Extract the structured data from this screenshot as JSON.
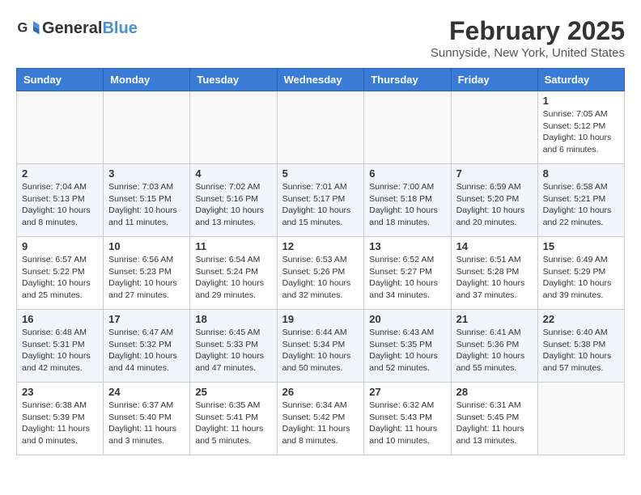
{
  "header": {
    "logo_text_general": "General",
    "logo_text_blue": "Blue",
    "title": "February 2025",
    "subtitle": "Sunnyside, New York, United States"
  },
  "weekdays": [
    "Sunday",
    "Monday",
    "Tuesday",
    "Wednesday",
    "Thursday",
    "Friday",
    "Saturday"
  ],
  "weeks": [
    [
      {
        "day": "",
        "info": ""
      },
      {
        "day": "",
        "info": ""
      },
      {
        "day": "",
        "info": ""
      },
      {
        "day": "",
        "info": ""
      },
      {
        "day": "",
        "info": ""
      },
      {
        "day": "",
        "info": ""
      },
      {
        "day": "1",
        "info": "Sunrise: 7:05 AM\nSunset: 5:12 PM\nDaylight: 10 hours\nand 6 minutes."
      }
    ],
    [
      {
        "day": "2",
        "info": "Sunrise: 7:04 AM\nSunset: 5:13 PM\nDaylight: 10 hours\nand 8 minutes."
      },
      {
        "day": "3",
        "info": "Sunrise: 7:03 AM\nSunset: 5:15 PM\nDaylight: 10 hours\nand 11 minutes."
      },
      {
        "day": "4",
        "info": "Sunrise: 7:02 AM\nSunset: 5:16 PM\nDaylight: 10 hours\nand 13 minutes."
      },
      {
        "day": "5",
        "info": "Sunrise: 7:01 AM\nSunset: 5:17 PM\nDaylight: 10 hours\nand 15 minutes."
      },
      {
        "day": "6",
        "info": "Sunrise: 7:00 AM\nSunset: 5:18 PM\nDaylight: 10 hours\nand 18 minutes."
      },
      {
        "day": "7",
        "info": "Sunrise: 6:59 AM\nSunset: 5:20 PM\nDaylight: 10 hours\nand 20 minutes."
      },
      {
        "day": "8",
        "info": "Sunrise: 6:58 AM\nSunset: 5:21 PM\nDaylight: 10 hours\nand 22 minutes."
      }
    ],
    [
      {
        "day": "9",
        "info": "Sunrise: 6:57 AM\nSunset: 5:22 PM\nDaylight: 10 hours\nand 25 minutes."
      },
      {
        "day": "10",
        "info": "Sunrise: 6:56 AM\nSunset: 5:23 PM\nDaylight: 10 hours\nand 27 minutes."
      },
      {
        "day": "11",
        "info": "Sunrise: 6:54 AM\nSunset: 5:24 PM\nDaylight: 10 hours\nand 29 minutes."
      },
      {
        "day": "12",
        "info": "Sunrise: 6:53 AM\nSunset: 5:26 PM\nDaylight: 10 hours\nand 32 minutes."
      },
      {
        "day": "13",
        "info": "Sunrise: 6:52 AM\nSunset: 5:27 PM\nDaylight: 10 hours\nand 34 minutes."
      },
      {
        "day": "14",
        "info": "Sunrise: 6:51 AM\nSunset: 5:28 PM\nDaylight: 10 hours\nand 37 minutes."
      },
      {
        "day": "15",
        "info": "Sunrise: 6:49 AM\nSunset: 5:29 PM\nDaylight: 10 hours\nand 39 minutes."
      }
    ],
    [
      {
        "day": "16",
        "info": "Sunrise: 6:48 AM\nSunset: 5:31 PM\nDaylight: 10 hours\nand 42 minutes."
      },
      {
        "day": "17",
        "info": "Sunrise: 6:47 AM\nSunset: 5:32 PM\nDaylight: 10 hours\nand 44 minutes."
      },
      {
        "day": "18",
        "info": "Sunrise: 6:45 AM\nSunset: 5:33 PM\nDaylight: 10 hours\nand 47 minutes."
      },
      {
        "day": "19",
        "info": "Sunrise: 6:44 AM\nSunset: 5:34 PM\nDaylight: 10 hours\nand 50 minutes."
      },
      {
        "day": "20",
        "info": "Sunrise: 6:43 AM\nSunset: 5:35 PM\nDaylight: 10 hours\nand 52 minutes."
      },
      {
        "day": "21",
        "info": "Sunrise: 6:41 AM\nSunset: 5:36 PM\nDaylight: 10 hours\nand 55 minutes."
      },
      {
        "day": "22",
        "info": "Sunrise: 6:40 AM\nSunset: 5:38 PM\nDaylight: 10 hours\nand 57 minutes."
      }
    ],
    [
      {
        "day": "23",
        "info": "Sunrise: 6:38 AM\nSunset: 5:39 PM\nDaylight: 11 hours\nand 0 minutes."
      },
      {
        "day": "24",
        "info": "Sunrise: 6:37 AM\nSunset: 5:40 PM\nDaylight: 11 hours\nand 3 minutes."
      },
      {
        "day": "25",
        "info": "Sunrise: 6:35 AM\nSunset: 5:41 PM\nDaylight: 11 hours\nand 5 minutes."
      },
      {
        "day": "26",
        "info": "Sunrise: 6:34 AM\nSunset: 5:42 PM\nDaylight: 11 hours\nand 8 minutes."
      },
      {
        "day": "27",
        "info": "Sunrise: 6:32 AM\nSunset: 5:43 PM\nDaylight: 11 hours\nand 10 minutes."
      },
      {
        "day": "28",
        "info": "Sunrise: 6:31 AM\nSunset: 5:45 PM\nDaylight: 11 hours\nand 13 minutes."
      },
      {
        "day": "",
        "info": ""
      }
    ]
  ]
}
